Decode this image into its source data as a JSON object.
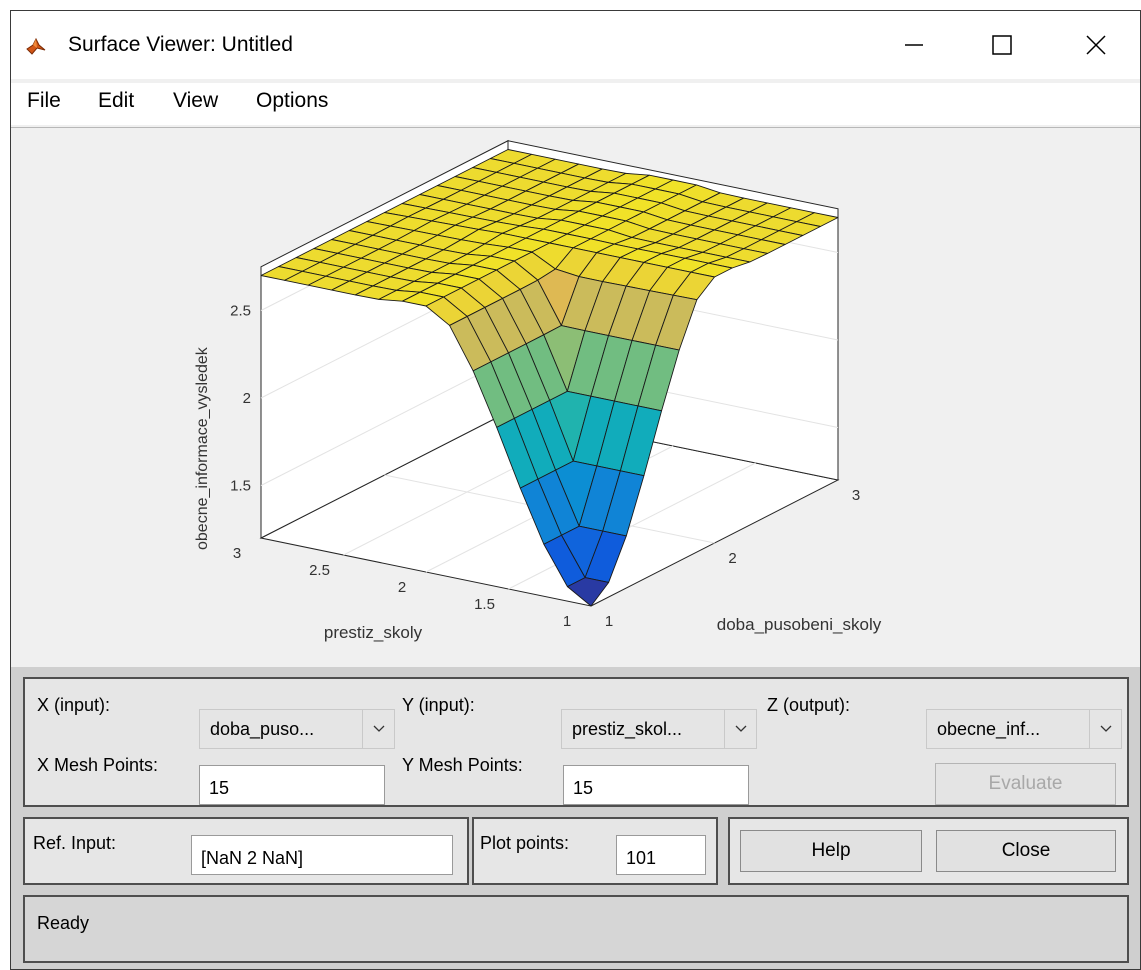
{
  "window": {
    "title": "Surface Viewer: Untitled",
    "app_icon": "matlab-membrane-icon",
    "controls": [
      "minimize-icon",
      "maximize-icon",
      "close-icon"
    ]
  },
  "menu": [
    "File",
    "Edit",
    "View",
    "Options"
  ],
  "plot": {
    "zlabel": "obecne_informace_vysledek",
    "xlabel": "doba_pusobeni_skoly",
    "ylabel": "prestiz_skoly",
    "xticks": [
      "1",
      "2",
      "3"
    ],
    "yticks": [
      "1",
      "1.5",
      "2",
      "2.5",
      "3"
    ],
    "zticks": [
      "1.5",
      "2",
      "2.5"
    ],
    "colormap": "parula"
  },
  "chart_data": {
    "type": "surface",
    "xlabel": "doba_pusobeni_skoly",
    "ylabel": "prestiz_skoly",
    "zlabel": "obecne_informace_vysledek",
    "xlim": [
      1,
      3
    ],
    "ylim": [
      1,
      3
    ],
    "zlim": [
      1.2,
      2.8
    ],
    "grid": true,
    "mesh_points": [
      15,
      15
    ],
    "x": [
      1,
      2,
      3
    ],
    "y": [
      1,
      2,
      3
    ],
    "z": [
      [
        1.2,
        1.7,
        2.7
      ],
      [
        1.7,
        2.7,
        2.7
      ],
      [
        2.7,
        2.7,
        2.7
      ]
    ]
  },
  "controls": {
    "x_input_label": "X (input):",
    "x_input_value": "doba_puso...",
    "y_input_label": "Y (input):",
    "y_input_value": "prestiz_skol...",
    "z_output_label": "Z (output):",
    "z_output_value": "obecne_inf...",
    "x_mesh_label": "X Mesh Points:",
    "x_mesh_value": "15",
    "y_mesh_label": "Y Mesh Points:",
    "y_mesh_value": "15",
    "evaluate_label": "Evaluate",
    "ref_input_label": "Ref. Input:",
    "ref_input_value": "[NaN 2 NaN]",
    "plot_points_label": "Plot points:",
    "plot_points_value": "101",
    "help_label": "Help",
    "close_label": "Close"
  },
  "status": {
    "text": "Ready"
  }
}
